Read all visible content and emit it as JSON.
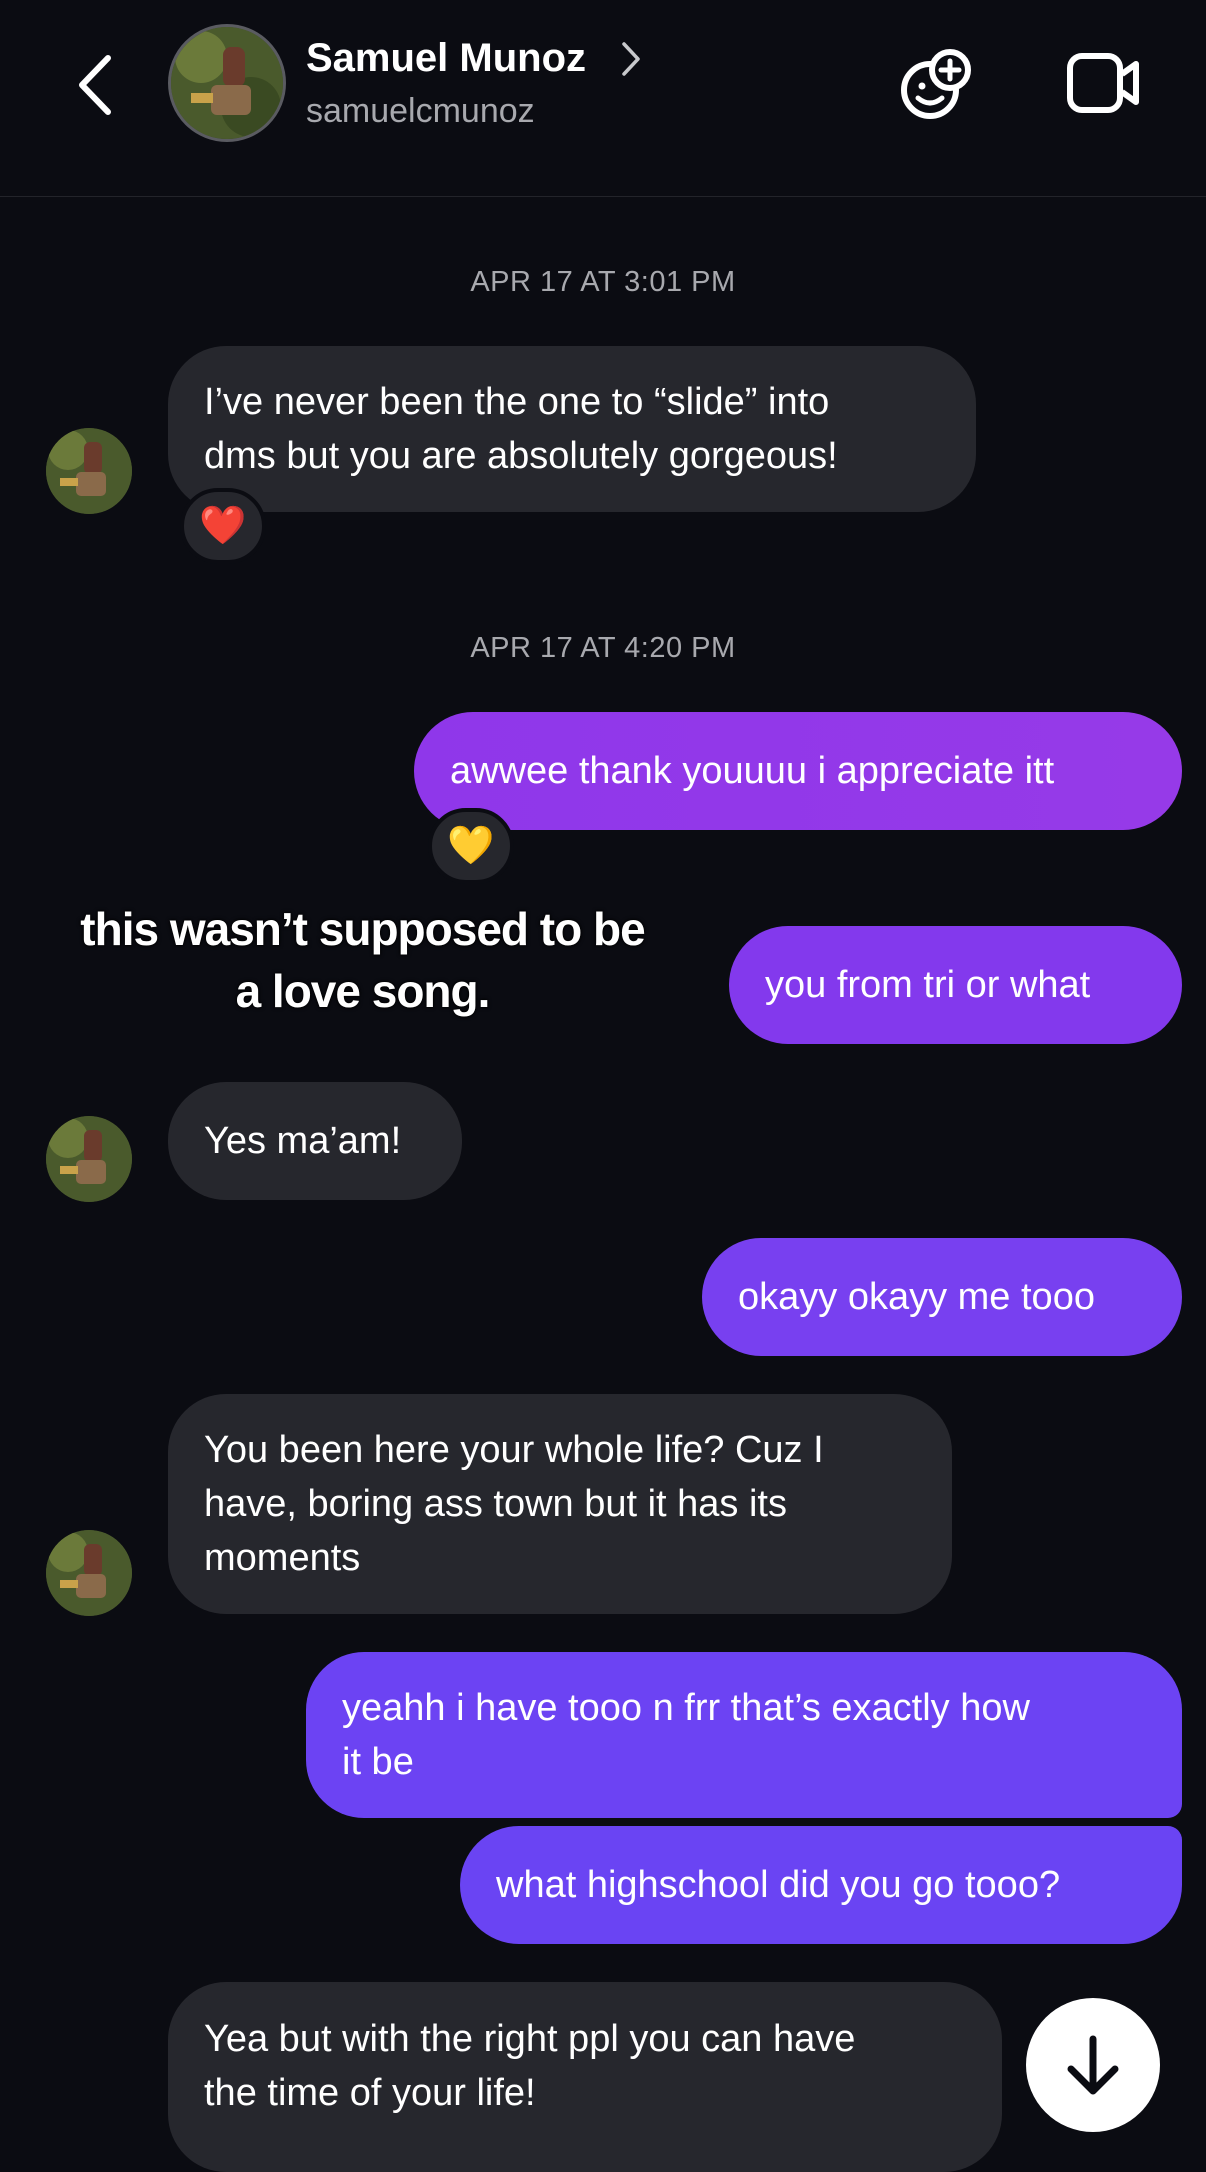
{
  "header": {
    "name": "Samuel Munoz",
    "username": "samuelcmunoz"
  },
  "icons": {
    "back": "chevron-left-icon",
    "profile_chevron": "chevron-right-icon",
    "effects": "smiley-plus-icon",
    "video": "video-camera-icon",
    "scroll": "arrow-down-icon"
  },
  "timestamps": {
    "t1": "APR 17 AT 3:01 PM",
    "t2": "APR 17 AT 4:20 PM"
  },
  "messages": [
    {
      "from": "them",
      "text": "I’ve never been the one to “slide” into\ndms but you are absolutely gorgeous!",
      "reaction": "❤️"
    },
    {
      "from": "me",
      "text": "awwee thank youuuu i appreciate itt",
      "reaction": "💛"
    },
    {
      "from": "me",
      "text": "you from tri or what"
    },
    {
      "from": "them",
      "text": "Yes ma’am!"
    },
    {
      "from": "me",
      "text": "okayy okayy me tooo"
    },
    {
      "from": "them",
      "text": "You been here your whole life? Cuz I\nhave, boring ass town but it has its\nmoments"
    },
    {
      "from": "me",
      "text": "yeahh i have tooo n frr that’s exactly how\nit be"
    },
    {
      "from": "me",
      "text": "what highschool did you go tooo?"
    },
    {
      "from": "them",
      "text": "Yea but with the right ppl you can have\nthe time of your life!"
    }
  ],
  "overlay_caption": "this wasn’t supposed to be\na love song.",
  "colors": {
    "background": "#0b0c12",
    "incoming_bubble": "#26272d",
    "outgoing_gradient_top": "#9a36e9",
    "outgoing_gradient_bottom": "#6b43f2"
  }
}
